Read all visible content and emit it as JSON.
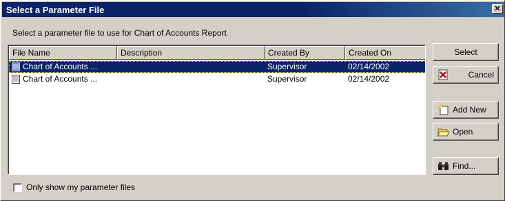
{
  "window": {
    "title": "Select a Parameter File",
    "close_glyph": "✕"
  },
  "instruction": "Select a parameter file to use for Chart of Accounts Report",
  "table": {
    "columns": [
      "File Name",
      "Description",
      "Created By",
      "Created On"
    ],
    "rows": [
      {
        "file_name": "Chart of Accounts ...",
        "description": "",
        "created_by": "Supervisor",
        "created_on": "02/14/2002",
        "selected": true,
        "icon": "document-icon"
      },
      {
        "file_name": "Chart of Accounts ...",
        "description": "",
        "created_by": "Supervisor",
        "created_on": "02/14/2002",
        "selected": false,
        "icon": "document-icon"
      }
    ]
  },
  "buttons": {
    "select": "Select",
    "cancel": "Cancel",
    "add_new": "Add New",
    "open": "Open",
    "find": "Find..."
  },
  "checkbox": {
    "label": "Only show my parameter files",
    "checked": false
  },
  "colors": {
    "titlebar": "#0a246a",
    "face": "#d4d0c8",
    "selection": "#0a246a"
  }
}
